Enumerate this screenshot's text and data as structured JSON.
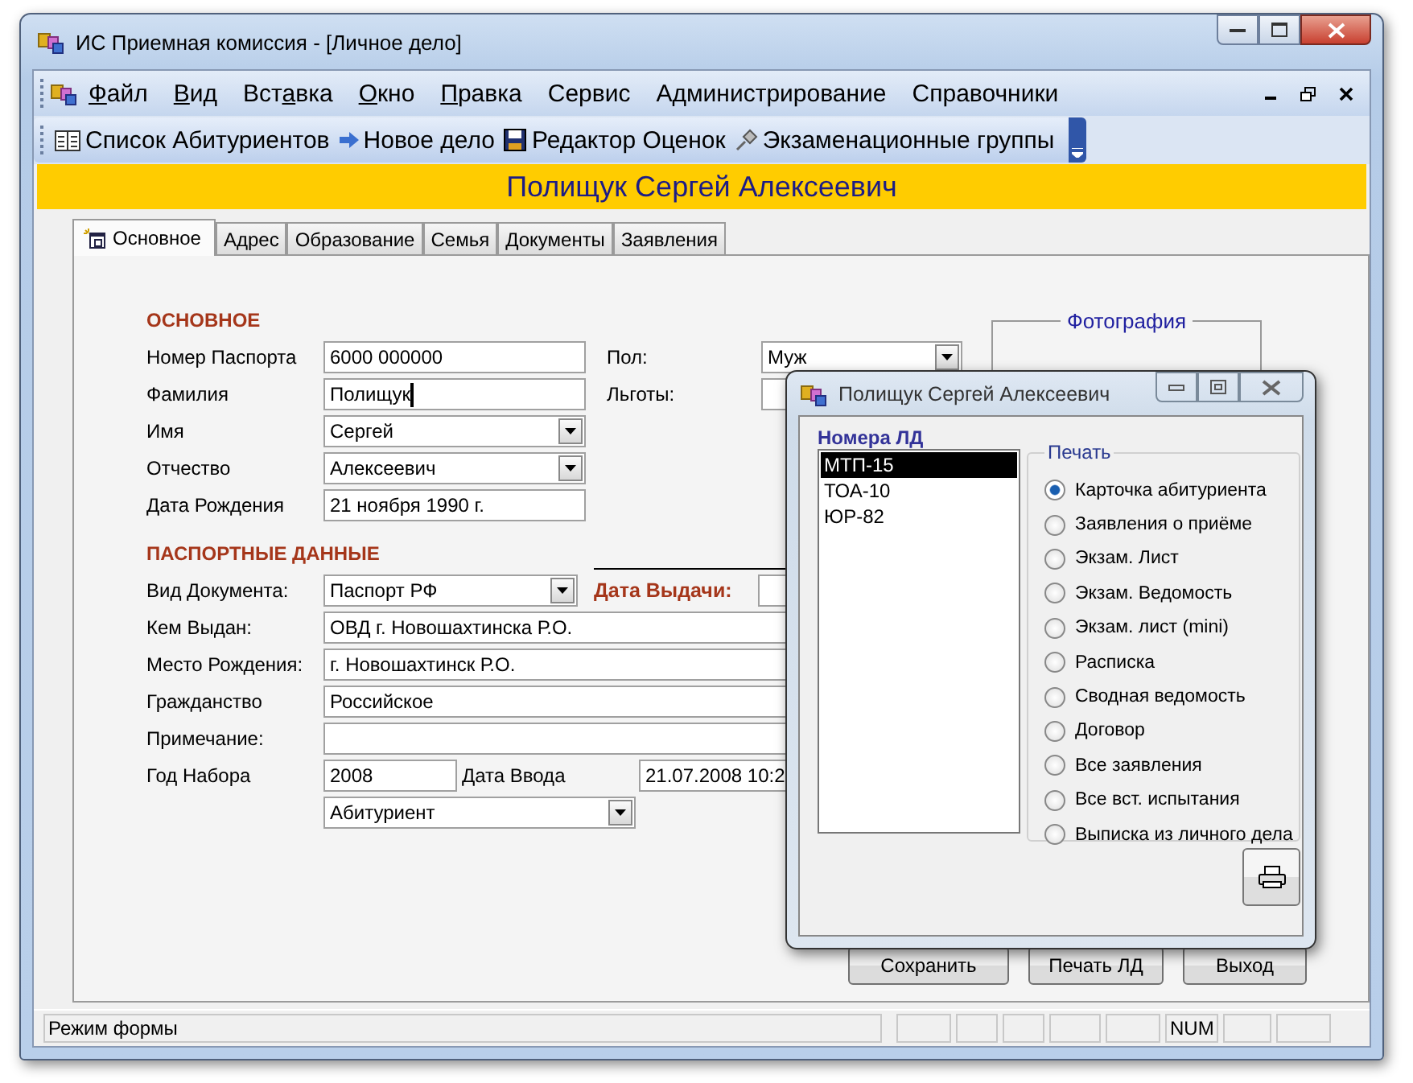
{
  "window": {
    "title": "ИС Приемная комиссия - [Личное дело]"
  },
  "menu": [
    {
      "key": "Ф",
      "after": "айл"
    },
    {
      "key": "В",
      "after": "ид"
    },
    {
      "before": "Вст",
      "key": "а",
      "after": "вка"
    },
    {
      "key": "О",
      "after": "кно"
    },
    {
      "key": "П",
      "after": "равка"
    },
    {
      "before": "Сервис"
    },
    {
      "before": "Администрирование"
    },
    {
      "before": "Справочники"
    }
  ],
  "toolbar": [
    {
      "label": "Список Абитуриентов",
      "kind": "list"
    },
    {
      "label": "Новое дело",
      "kind": "arrow"
    },
    {
      "label": "Редактор Оценок",
      "kind": "disk"
    },
    {
      "label": "Экзаменационные группы",
      "kind": "pin"
    }
  ],
  "header": "Полищук Сергей Алексеевич",
  "tabs": [
    {
      "label": "Основное",
      "selected": true
    },
    {
      "label": "Адрес",
      "selected": false
    },
    {
      "label": "Образование",
      "selected": false
    },
    {
      "label": "Семья",
      "selected": false
    },
    {
      "label": "Документы",
      "selected": false
    },
    {
      "label": "Заявления",
      "selected": false
    }
  ],
  "form": {
    "section_1": "ОСНОВНОЕ",
    "fields_left": [
      {
        "label": "Номер Паспорта",
        "value": "6000 000000",
        "kind": "text"
      },
      {
        "label": "Фамилия",
        "value": "Полищук",
        "kind": "text",
        "focused": true
      },
      {
        "label": "Имя",
        "value": "Сергей",
        "kind": "combo"
      },
      {
        "label": "Отчество",
        "value": "Алексеевич",
        "kind": "combo"
      },
      {
        "label": "Дата Рождения",
        "value": "21 ноября 1990 г.",
        "kind": "text"
      }
    ],
    "fields_right": [
      {
        "label": "Пол:",
        "value": "Муж",
        "kind": "combo"
      },
      {
        "label": "Льготы:",
        "kind": "text"
      }
    ],
    "photo": {
      "legend": "Фотография"
    },
    "section_2": "ПАСПОРТНЫЕ ДАННЫЕ",
    "doc_type": {
      "label": "Вид Документа:",
      "value": "Паспорт РФ"
    },
    "issue_date": {
      "label": "Дата Выдачи:"
    },
    "rows": [
      {
        "label": "Кем Выдан:",
        "value": "ОВД г. Новошахтинска Р.О."
      },
      {
        "label": "Место Рождения:",
        "value": "г. Новошахтинск Р.О."
      },
      {
        "label": "Гражданство",
        "value": "Российское"
      },
      {
        "label": "Примечание:"
      }
    ],
    "year": {
      "label": "Год Набора",
      "value": "2008"
    },
    "entry_date": {
      "label": "Дата Ввода",
      "value": "21.07.2008 10:2"
    },
    "status": {
      "value": "Абитуриент"
    }
  },
  "buttons": [
    "Сохранить",
    "Печать ЛД",
    "Выход"
  ],
  "status_bar": {
    "text": "Режим формы",
    "num": "NUM"
  },
  "dialog": {
    "title": "Полищук Сергей Алексеевич",
    "list_label": "Номера ЛД",
    "records": [
      {
        "label": "МТП-15",
        "selected": true
      },
      {
        "label": "ТОА-10",
        "selected": false
      },
      {
        "label": "ЮР-82",
        "selected": false
      }
    ],
    "print_group": "Печать",
    "options": [
      {
        "label": "Карточка абитуриента",
        "selected": true
      },
      {
        "label": "Заявления о приёме",
        "selected": false
      },
      {
        "label": "Экзам. Лист",
        "selected": false
      },
      {
        "label": "Экзам. Ведомость",
        "selected": false
      },
      {
        "label": "Экзам. лист (mini)",
        "selected": false
      },
      {
        "label": "Расписка",
        "selected": false
      },
      {
        "label": "Сводная ведомость",
        "selected": false
      },
      {
        "label": "Договор",
        "selected": false
      },
      {
        "label": "Все заявления",
        "selected": false
      },
      {
        "label": "Все вст. испытания",
        "selected": false
      },
      {
        "label": "Выписка из личного дела",
        "selected": false
      }
    ]
  }
}
